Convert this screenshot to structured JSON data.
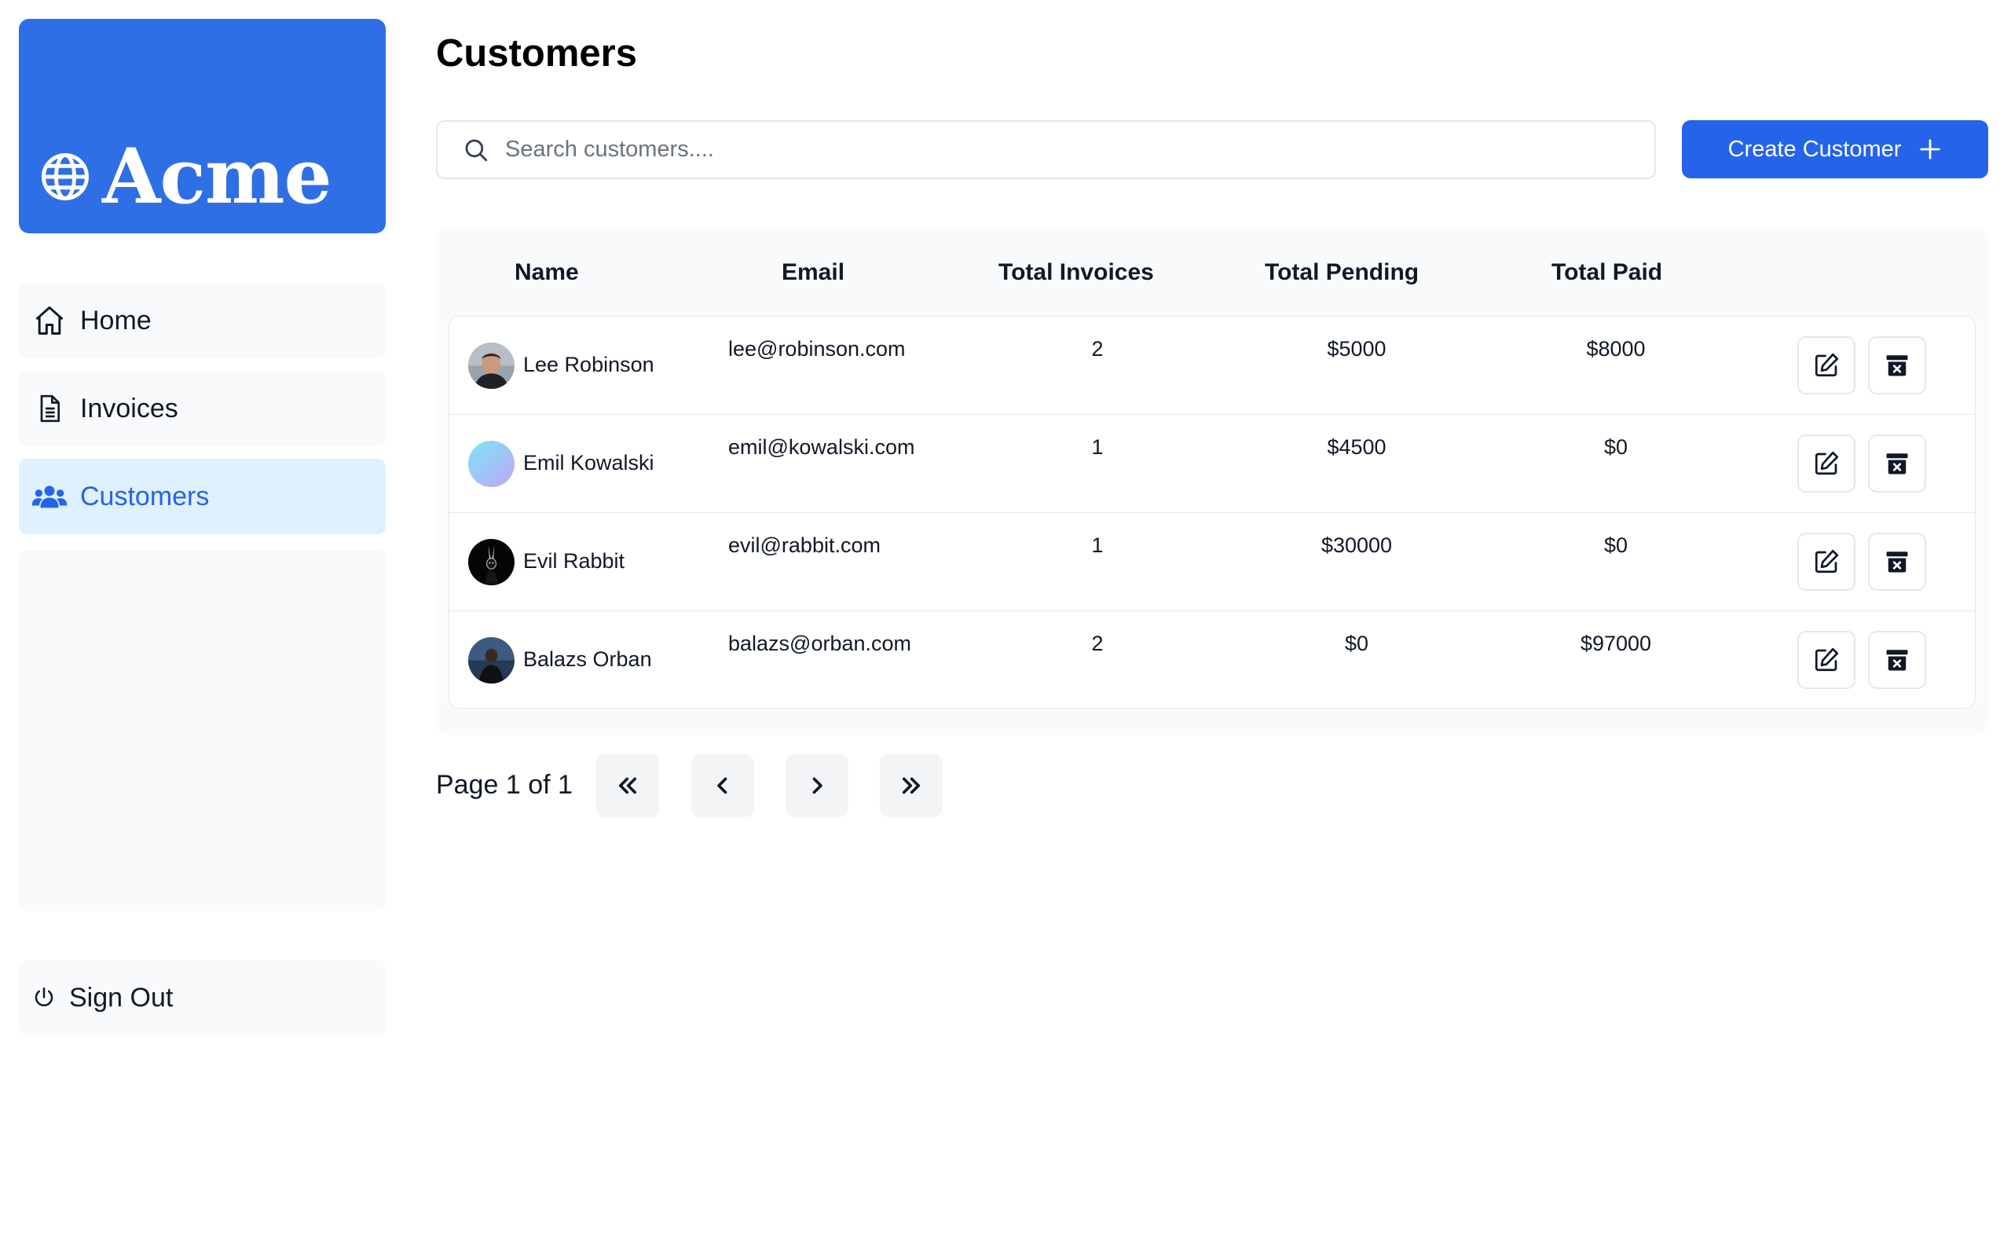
{
  "sidebar": {
    "logo_text": "Acme",
    "brand_color": "#2f6fe6",
    "items": [
      {
        "label": "Home",
        "icon": "home-icon"
      },
      {
        "label": "Invoices",
        "icon": "document-icon"
      },
      {
        "label": "Customers",
        "icon": "users-icon",
        "active": true
      }
    ],
    "signout_label": "Sign Out"
  },
  "main": {
    "title": "Customers",
    "search_placeholder": "Search customers....",
    "create_label": "Create Customer",
    "accent_color": "#2563eb"
  },
  "table": {
    "headers": [
      "Name",
      "Email",
      "Total Invoices",
      "Total Pending",
      "Total Paid"
    ],
    "rows": [
      {
        "name": "Lee Robinson",
        "email": "lee@robinson.com",
        "invoices": "2",
        "pending": "$5000",
        "paid": "$8000"
      },
      {
        "name": "Emil Kowalski",
        "email": "emil@kowalski.com",
        "invoices": "1",
        "pending": "$4500",
        "paid": "$0"
      },
      {
        "name": "Evil Rabbit",
        "email": "evil@rabbit.com",
        "invoices": "1",
        "pending": "$30000",
        "paid": "$0"
      },
      {
        "name": "Balazs Orban",
        "email": "balazs@orban.com",
        "invoices": "2",
        "pending": "$0",
        "paid": "$97000"
      }
    ]
  },
  "pagination": {
    "text": "Page 1 of 1"
  }
}
